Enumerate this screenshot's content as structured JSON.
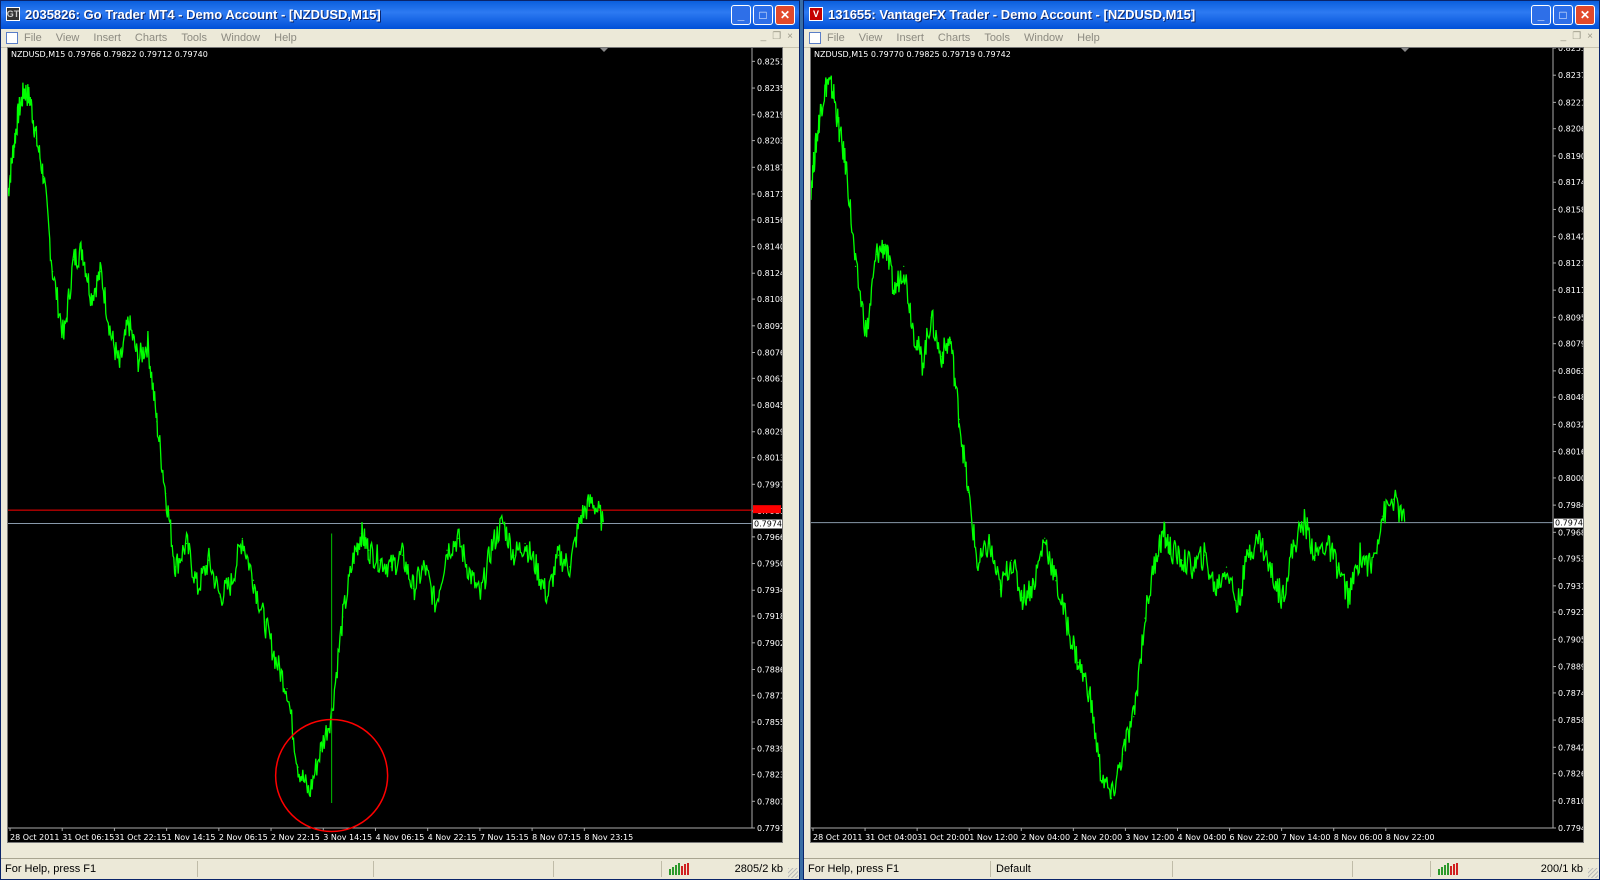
{
  "windows": [
    {
      "title": "2035826: Go Trader MT4 - Demo Account - [NZDUSD,M15]",
      "app_icon": "GT",
      "menu": [
        "File",
        "View",
        "Insert",
        "Charts",
        "Tools",
        "Window",
        "Help"
      ],
      "chart_header": "NZDUSD,M15  0.79766 0.79822 0.79712 0.79740",
      "status": {
        "help": "For Help, press F1",
        "profile": "",
        "traffic": "2805/2 kb"
      },
      "chart_data": {
        "type": "line",
        "symbol": "NZDUSD,M15",
        "ohlc_header": {
          "open": 0.79766,
          "high": 0.79822,
          "low": 0.79712,
          "close": 0.7974
        },
        "ylim": [
          0.77915,
          0.8259
        ],
        "y_ticks": [
          "0.82510",
          "0.82350",
          "0.82190",
          "0.82035",
          "0.81875",
          "0.81715",
          "0.81560",
          "0.81400",
          "0.81240",
          "0.81085",
          "0.80925",
          "0.80765",
          "0.80610",
          "0.80450",
          "0.80290",
          "0.80135",
          "0.79975",
          "0.79815",
          "0.79660",
          "0.79500",
          "0.79340",
          "0.79185",
          "0.79025",
          "0.78865",
          "0.78710",
          "0.78550",
          "0.78390",
          "0.78235",
          "0.78075",
          "0.77915"
        ],
        "x_ticks": [
          "28 Oct 2011",
          "31 Oct 06:15",
          "31 Oct 22:15",
          "1 Nov 14:15",
          "2 Nov 06:15",
          "2 Nov 22:15",
          "3 Nov 14:15",
          "4 Nov 06:15",
          "4 Nov 22:15",
          "7 Nov 15:15",
          "8 Nov 07:15",
          "8 Nov 23:15"
        ],
        "ask_line": 0.7982,
        "bid_line": 0.7974,
        "bid_label": "0.79740",
        "spike_low": 0.78065,
        "annotation": "red circle around spike low",
        "series": [
          {
            "x": [
              0,
              0.007,
              0.014,
              0.022,
              0.03,
              0.038,
              0.048,
              0.06,
              0.075,
              0.088,
              0.1,
              0.112,
              0.125,
              0.138,
              0.15,
              0.162,
              0.175,
              0.188,
              0.2,
              0.212,
              0.225,
              0.24,
              0.255,
              0.27,
              0.285,
              0.3,
              0.315,
              0.33,
              0.345,
              0.36,
              0.375,
              0.39,
              0.405,
              0.42,
              0.435,
              0.45,
              0.465,
              0.475,
              0.485,
              0.5,
              0.515,
              0.53,
              0.545,
              0.56,
              0.575,
              0.59,
              0.605,
              0.62,
              0.635,
              0.65,
              0.665,
              0.68,
              0.695,
              0.71,
              0.725,
              0.74,
              0.755,
              0.77,
              0.785,
              0.8
            ],
            "y": [
              0.8172,
              0.8198,
              0.822,
              0.8234,
              0.8228,
              0.8205,
              0.8182,
              0.8125,
              0.8085,
              0.8132,
              0.8138,
              0.811,
              0.8125,
              0.8088,
              0.8068,
              0.8095,
              0.8072,
              0.8082,
              0.8035,
              0.7992,
              0.7948,
              0.7962,
              0.7935,
              0.7952,
              0.793,
              0.7938,
              0.7965,
              0.794,
              0.7915,
              0.7892,
              0.7875,
              0.7828,
              0.7812,
              0.7838,
              0.786,
              0.7918,
              0.7955,
              0.7968,
              0.7958,
              0.7952,
              0.7948,
              0.7955,
              0.7935,
              0.7948,
              0.7925,
              0.7958,
              0.7965,
              0.7945,
              0.793,
              0.796,
              0.7975,
              0.7955,
              0.7962,
              0.7948,
              0.793,
              0.7955,
              0.7948,
              0.7978,
              0.7988,
              0.7975
            ]
          }
        ]
      }
    },
    {
      "title": "131655: VantageFX Trader - Demo Account - [NZDUSD,M15]",
      "app_icon": "V",
      "menu": [
        "File",
        "View",
        "Insert",
        "Charts",
        "Tools",
        "Window",
        "Help"
      ],
      "chart_header": "NZDUSD,M15  0.79770 0.79825 0.79719 0.79742",
      "status": {
        "help": "For Help, press F1",
        "profile": "Default",
        "traffic": "200/1 kb"
      },
      "chart_data": {
        "type": "line",
        "symbol": "NZDUSD,M15",
        "ohlc_header": {
          "open": 0.7977,
          "high": 0.79825,
          "low": 0.79719,
          "close": 0.79742
        },
        "ylim": [
          0.77945,
          0.82535
        ],
        "y_ticks": [
          "0.82535",
          "0.82375",
          "0.82215",
          "0.82060",
          "0.81900",
          "0.81745",
          "0.81585",
          "0.81425",
          "0.81270",
          "0.81110",
          "0.80950",
          "0.80795",
          "0.80635",
          "0.80480",
          "0.80320",
          "0.80160",
          "0.80005",
          "0.79845",
          "0.79685",
          "0.79530",
          "0.79370",
          "0.79215",
          "0.79055",
          "0.78895",
          "0.78740",
          "0.78580",
          "0.78420",
          "0.78265",
          "0.78105",
          "0.77945"
        ],
        "x_ticks": [
          "28 Oct 2011",
          "31 Oct 04:00",
          "31 Oct 20:00",
          "1 Nov 12:00",
          "2 Nov 04:00",
          "2 Nov 20:00",
          "3 Nov 12:00",
          "4 Nov 04:00",
          "6 Nov 22:00",
          "7 Nov 14:00",
          "8 Nov 06:00",
          "8 Nov 22:00"
        ],
        "bid_line": 0.79742,
        "bid_label": "0.79742",
        "series": [
          {
            "x": [
              0,
              0.007,
              0.014,
              0.022,
              0.03,
              0.038,
              0.048,
              0.06,
              0.075,
              0.088,
              0.1,
              0.112,
              0.125,
              0.138,
              0.15,
              0.162,
              0.175,
              0.188,
              0.2,
              0.212,
              0.225,
              0.24,
              0.255,
              0.27,
              0.285,
              0.3,
              0.315,
              0.33,
              0.345,
              0.36,
              0.375,
              0.39,
              0.405,
              0.42,
              0.435,
              0.45,
              0.465,
              0.475,
              0.485,
              0.5,
              0.515,
              0.53,
              0.545,
              0.56,
              0.575,
              0.59,
              0.605,
              0.62,
              0.635,
              0.65,
              0.665,
              0.68,
              0.695,
              0.71,
              0.725,
              0.74,
              0.755,
              0.77,
              0.785,
              0.8
            ],
            "y": [
              0.8172,
              0.8198,
              0.822,
              0.8234,
              0.8228,
              0.8205,
              0.8182,
              0.8125,
              0.8085,
              0.8132,
              0.8138,
              0.811,
              0.8125,
              0.8088,
              0.8068,
              0.8095,
              0.8072,
              0.8082,
              0.8035,
              0.7992,
              0.7948,
              0.7962,
              0.7935,
              0.7952,
              0.793,
              0.7938,
              0.7965,
              0.794,
              0.7915,
              0.7892,
              0.7875,
              0.7828,
              0.7812,
              0.7838,
              0.786,
              0.7918,
              0.7955,
              0.7968,
              0.7958,
              0.7952,
              0.7948,
              0.7955,
              0.7935,
              0.7948,
              0.7925,
              0.7958,
              0.7965,
              0.7945,
              0.793,
              0.796,
              0.7975,
              0.7955,
              0.7962,
              0.7948,
              0.793,
              0.7955,
              0.7948,
              0.7978,
              0.7988,
              0.7975
            ]
          }
        ]
      }
    }
  ],
  "colors": {
    "price_line": "#00ff00",
    "ask_line": "#ff0000",
    "bid_line": "#8899aa",
    "annotation": "#ff0000",
    "chart_bg": "#000000",
    "spike": "#00c000"
  }
}
